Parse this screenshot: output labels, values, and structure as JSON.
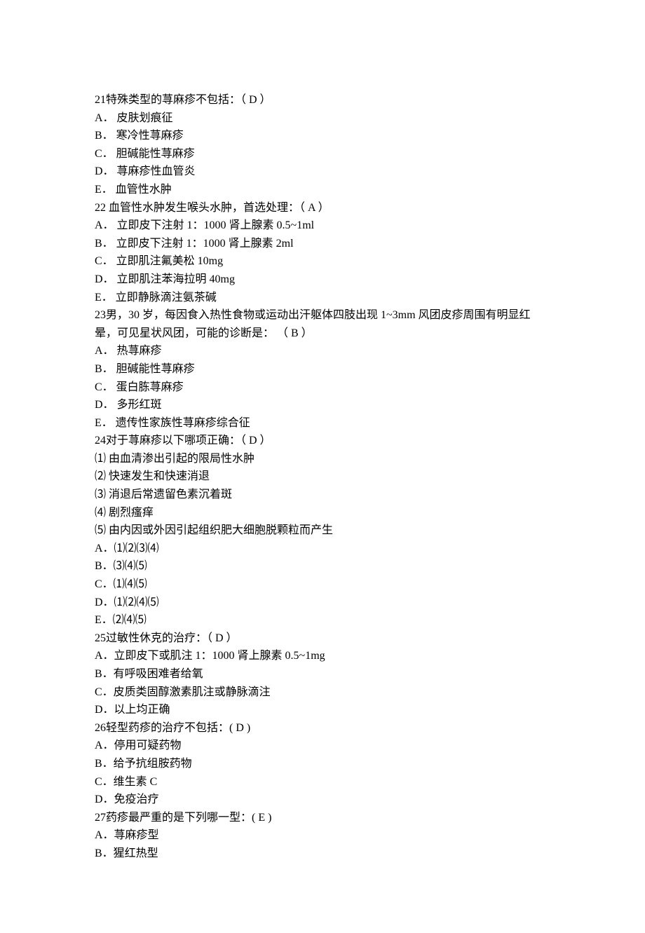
{
  "questions": [
    {
      "stem": "21特殊类型的荨麻疹不包括：（ D ）",
      "options": [
        "A． 皮肤划痕征",
        "B． 寒冷性荨麻疹",
        "C． 胆碱能性荨麻疹",
        "D． 荨麻疹性血管炎",
        "E． 血管性水肿"
      ]
    },
    {
      "stem": "22 血管性水肿发生喉头水肿，首选处理：（ A ）",
      "options": [
        "A． 立即皮下注射 1：1000 肾上腺素 0.5~1ml",
        "B． 立即皮下注射 1：1000 肾上腺素 2ml",
        "C． 立即肌注氟美松 10mg",
        "D． 立即肌注苯海拉明 40mg",
        "E． 立即静脉滴注氨茶碱"
      ]
    },
    {
      "stem": "23男，30 岁，每因食入热性食物或运动出汗躯体四肢出现 1~3mm 风团皮疹周围有明显红晕，可见星状风团，可能的诊断是： （ B ）",
      "options": [
        "A． 热荨麻疹",
        "B． 胆碱能性荨麻疹",
        "C． 蛋白胨荨麻疹",
        "D． 多形红斑",
        "E． 遗传性家族性荨麻疹综合征"
      ]
    },
    {
      "stem": "24对于荨麻疹以下哪项正确：（ D ）",
      "options": [
        "⑴ 由血清渗出引起的限局性水肿",
        "⑵ 快速发生和快速消退",
        "⑶ 消退后常遗留色素沉着斑",
        "⑷ 剧烈瘙痒",
        "⑸ 由内因或外因引起组织肥大细胞脱颗粒而产生",
        "A．⑴⑵⑶⑷",
        "B．⑶⑷⑸",
        "C．⑴⑷⑸",
        "D．⑴⑵⑷⑸",
        "E．⑵⑷⑸"
      ]
    },
    {
      "stem": "25过敏性休克的治疗：（ D ）",
      "options": [
        "A．立即皮下或肌注 1：1000 肾上腺素 0.5~1mg",
        "B．有呼吸困难者给氧",
        "C．皮质类固醇激素肌注或静脉滴注",
        "D．以上均正确"
      ]
    },
    {
      "stem": "26轻型药疹的治疗不包括：( D )",
      "options": [
        "A．停用可疑药物",
        "B．给予抗组胺药物",
        "C．维生素 C",
        "D．免疫治疗"
      ]
    },
    {
      "stem": "27药疹最严重的是下列哪一型：( E )",
      "options": [
        "A．荨麻疹型",
        "B．猩红热型"
      ]
    }
  ]
}
